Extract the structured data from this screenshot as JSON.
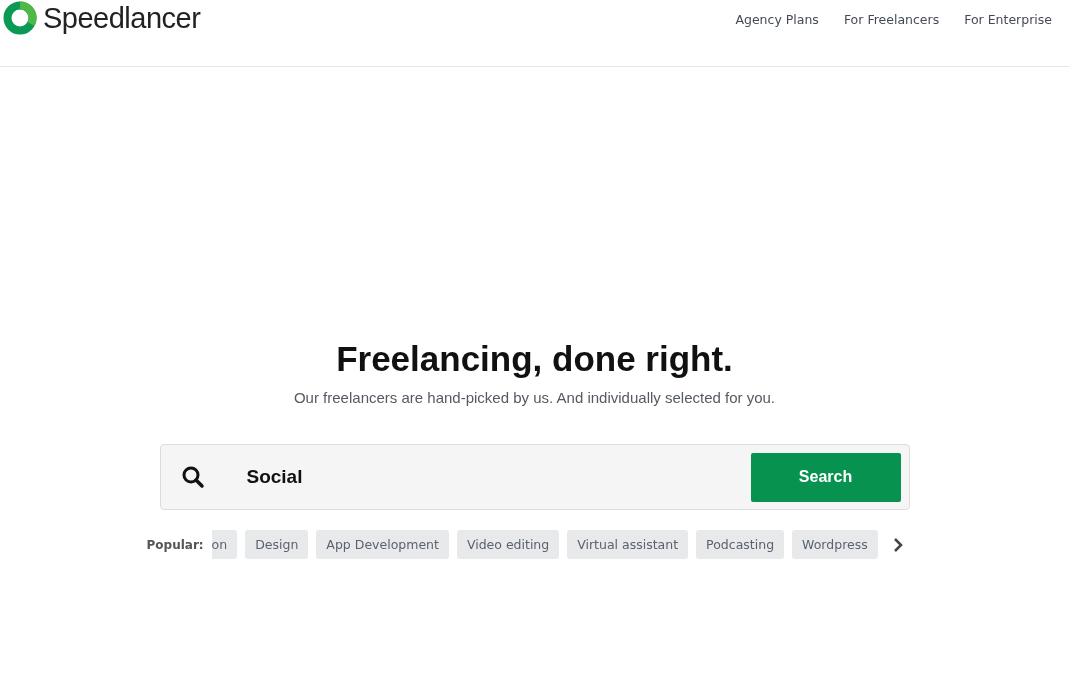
{
  "header": {
    "logo": "Speedlancer",
    "nav": [
      "Agency Plans",
      "For Freelancers",
      "For Enterprise"
    ]
  },
  "hero": {
    "title": "Freelancing, done right.",
    "subtitle": "Our freelancers are hand-picked by us. And individually selected for you."
  },
  "search": {
    "value": "Social",
    "button": "Search"
  },
  "popular": {
    "label": "Popular:",
    "tags": [
      {
        "label": "on",
        "cut": true
      },
      {
        "label": "Design",
        "cut": false
      },
      {
        "label": "App Development",
        "cut": false
      },
      {
        "label": "Video editing",
        "cut": false
      },
      {
        "label": "Virtual assistant",
        "cut": false
      },
      {
        "label": "Podcasting",
        "cut": false
      },
      {
        "label": "Wordpress",
        "cut": false
      }
    ]
  }
}
